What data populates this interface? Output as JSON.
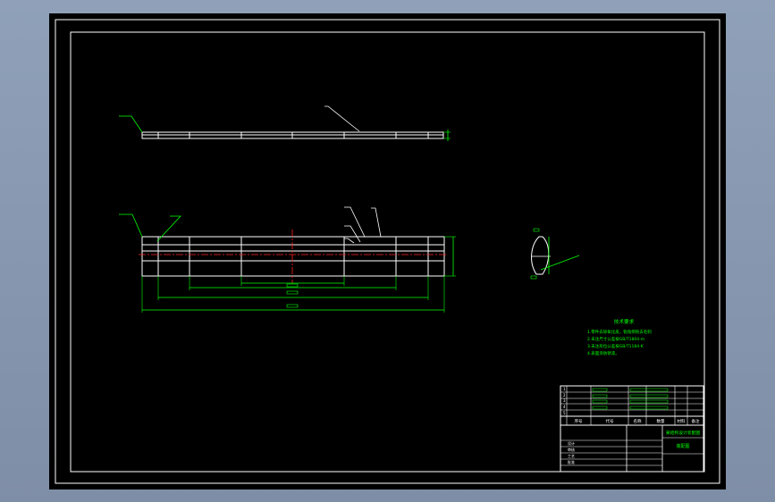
{
  "drawing": {
    "technical_requirements_title": "技术要求",
    "technical_requirements_lines": [
      "1.零件去除氧化皮，锐角倒钝去毛刺",
      "2.未注尺寸公差按GB/T1804-m",
      "3.未注形位公差按GB/T1184-K",
      "4.表面涂防锈漆。"
    ],
    "title_block": {
      "drawing_name": "某结构设计装配图",
      "assembly_label": "装配图",
      "header_seq": "序号",
      "header_code": "代号",
      "header_name": "名称",
      "header_qty": "数量",
      "header_material": "材料",
      "header_weight": "重量",
      "header_note": "备注",
      "rows": [
        {
          "seq": "1",
          "code": "",
          "name": ""
        },
        {
          "seq": "2",
          "code": "",
          "name": ""
        },
        {
          "seq": "3",
          "code": "",
          "name": ""
        },
        {
          "seq": "4",
          "code": "",
          "name": ""
        },
        {
          "seq": "5",
          "code": "",
          "name": ""
        }
      ],
      "sign_rows": [
        "设计",
        "审核",
        "工艺",
        "批准"
      ]
    }
  }
}
